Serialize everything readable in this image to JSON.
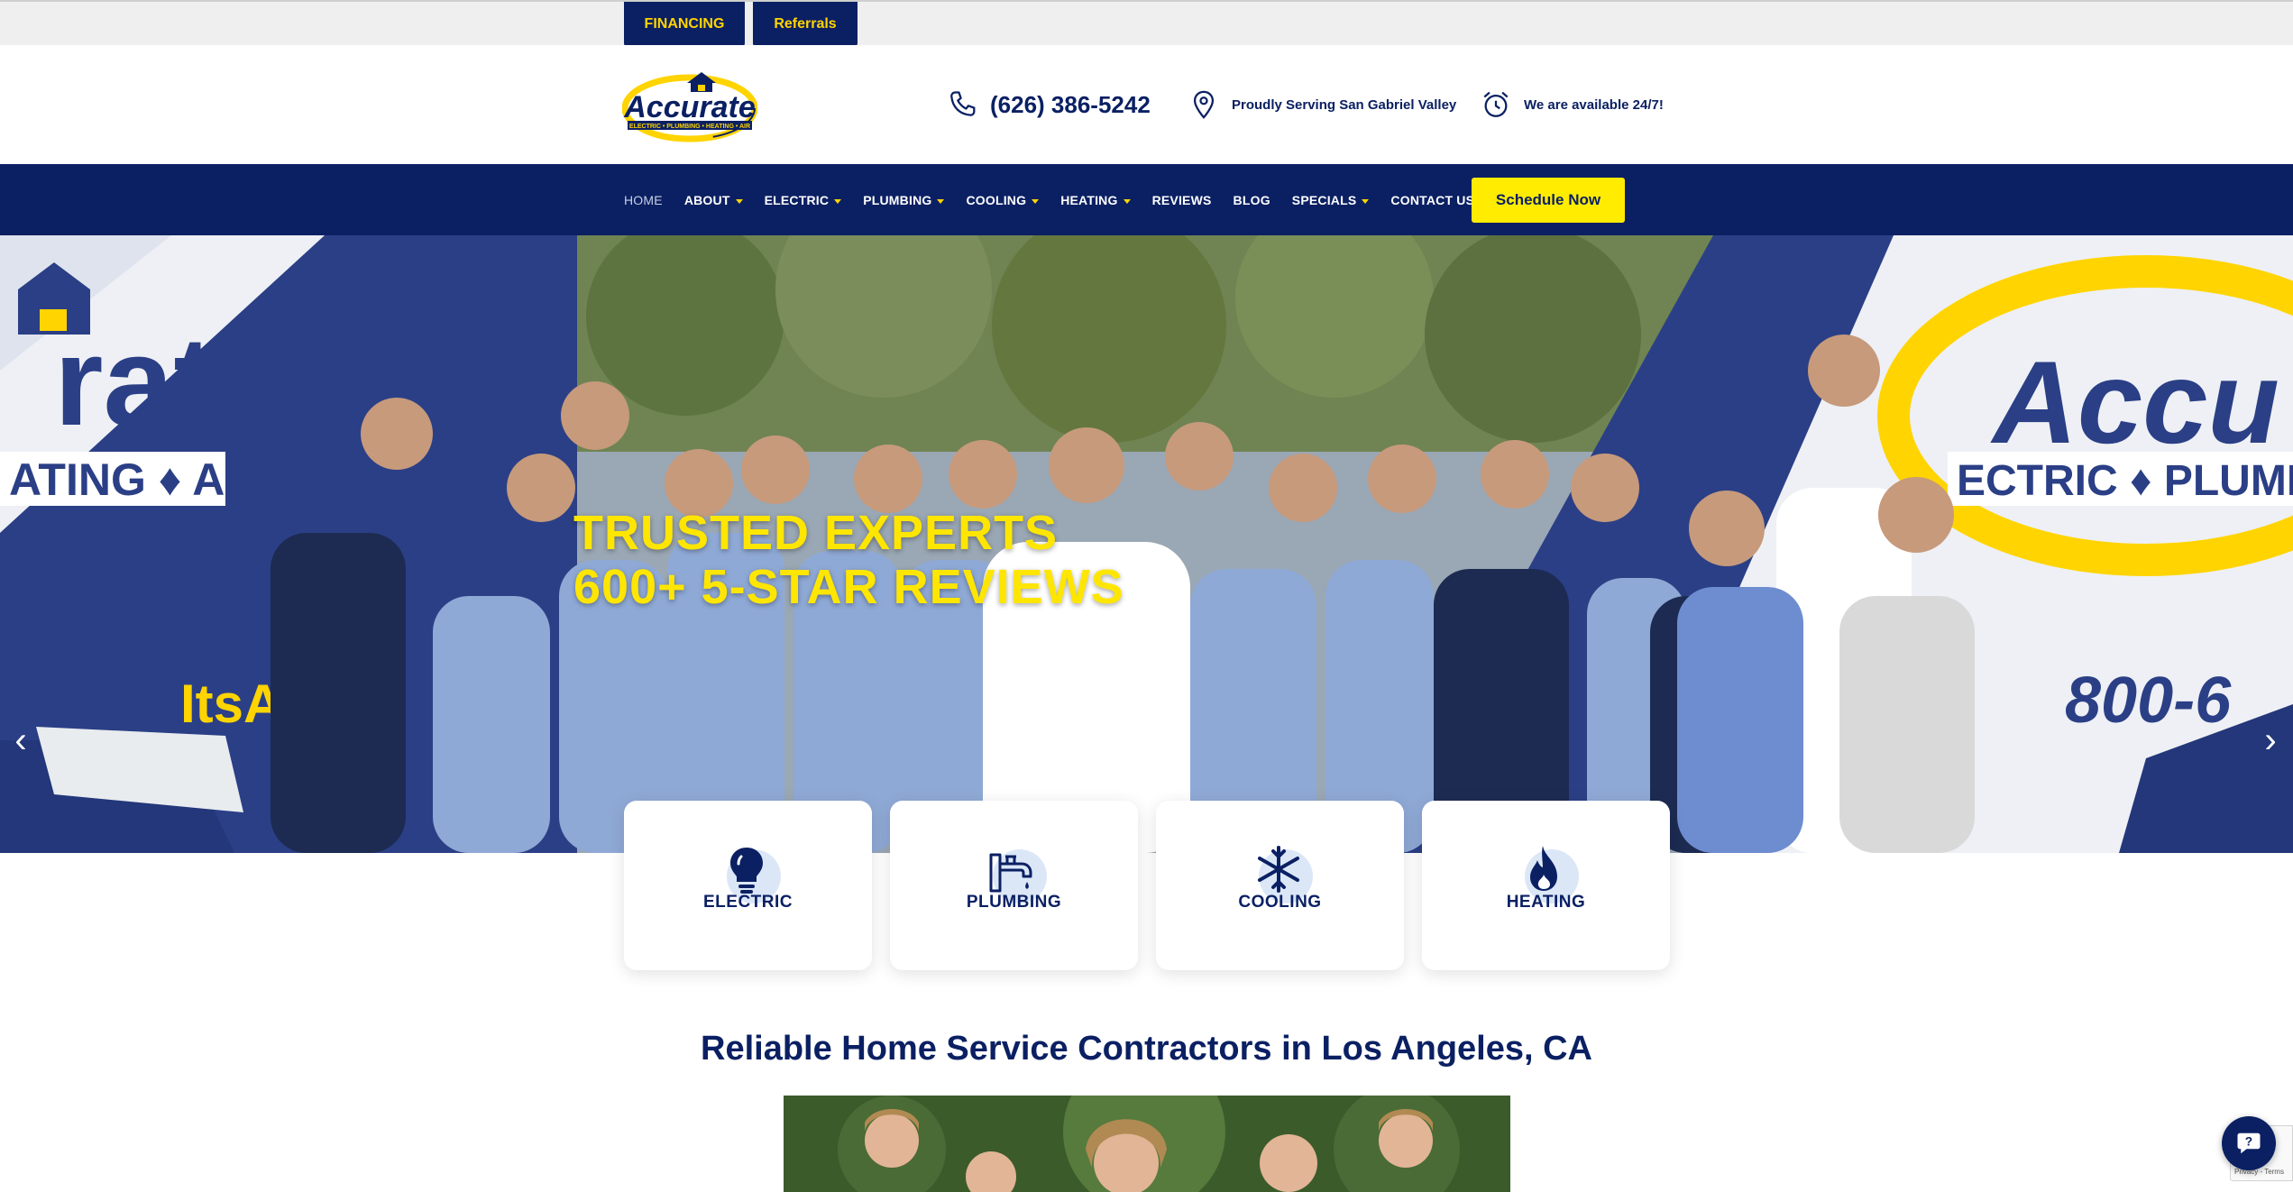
{
  "topbar": {
    "financing_label": "FINANCING",
    "referrals_label": "Referrals"
  },
  "header": {
    "logo_text": "Accurate",
    "logo_tagline": "ELECTRIC • PLUMBING • HEATING • AIR",
    "phone": "(626) 386-5242",
    "service_area": "Proudly Serving San Gabriel Valley",
    "availability": "We are available 24/7!"
  },
  "nav": {
    "items": [
      {
        "label": "HOME",
        "dropdown": false
      },
      {
        "label": "ABOUT",
        "dropdown": true
      },
      {
        "label": "ELECTRIC",
        "dropdown": true
      },
      {
        "label": "PLUMBING",
        "dropdown": true
      },
      {
        "label": "COOLING",
        "dropdown": true
      },
      {
        "label": "HEATING",
        "dropdown": true
      },
      {
        "label": "REVIEWS",
        "dropdown": false
      },
      {
        "label": "BLOG",
        "dropdown": false
      },
      {
        "label": "SPECIALS",
        "dropdown": true
      },
      {
        "label": "CONTACT US",
        "dropdown": false
      }
    ],
    "schedule_label": "Schedule Now"
  },
  "hero": {
    "line1": "TRUSTED EXPERTS",
    "line2": "600+ 5-STAR REVIEWS",
    "van_text_left": "rate",
    "van_sub_left": "ATING ♦ AIR",
    "van_text_right": "Accu",
    "van_sub_right": "ECTRIC ♦ PLUMBIN",
    "van_phone": "800-6",
    "van_url": "ItsAc"
  },
  "services": [
    {
      "label": "ELECTRIC",
      "icon": "lightbulb-icon"
    },
    {
      "label": "PLUMBING",
      "icon": "faucet-icon"
    },
    {
      "label": "COOLING",
      "icon": "snowflake-icon"
    },
    {
      "label": "HEATING",
      "icon": "flame-icon"
    }
  ],
  "section_title": "Reliable Home Service Contractors in Los Angeles, CA",
  "recaptcha_text": "Privacy - Terms",
  "colors": {
    "navy": "#0b2063",
    "yellow": "#ffec00",
    "accent_yellow": "#ffd400"
  }
}
